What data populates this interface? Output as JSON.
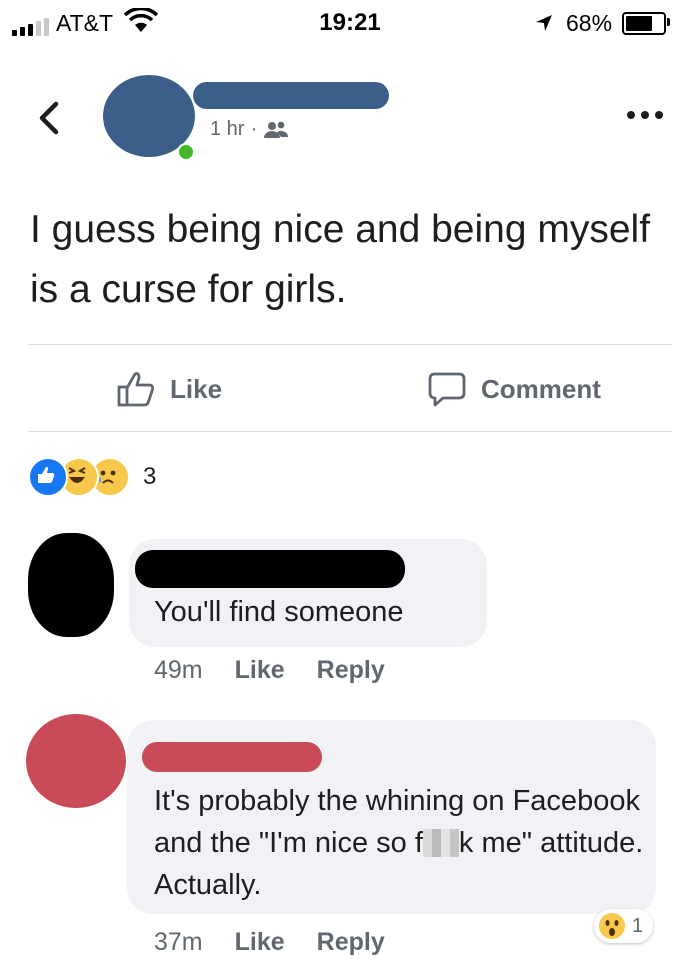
{
  "status_bar": {
    "carrier": "AT&T",
    "time": "19:21",
    "battery": "68%",
    "battery_level": 0.68
  },
  "post": {
    "timestamp": "1 hr",
    "separator": "·",
    "privacy_icon": "friends-icon",
    "text": "I guess being nice and being myself is a curse for girls."
  },
  "actions": {
    "like": "Like",
    "comment": "Comment"
  },
  "reactions": {
    "icons": [
      "like-icon",
      "haha-icon",
      "sad-icon"
    ],
    "count": "3"
  },
  "comments": [
    {
      "text": "You'll find someone",
      "time": "49m",
      "like": "Like",
      "reply": "Reply"
    },
    {
      "text_part1": "It's probably the whining on Facebook and the \"I'm nice so f",
      "text_part2": "k me\" attitude. Actually.",
      "time": "37m",
      "like": "Like",
      "reply": "Reply",
      "reaction_count": "1",
      "reaction_icon": "wow-icon"
    }
  ],
  "colors": {
    "facebook_blue": "#1877f2",
    "text": "#1c1e21",
    "meta": "#606770",
    "bubble": "#f0f2f5"
  }
}
